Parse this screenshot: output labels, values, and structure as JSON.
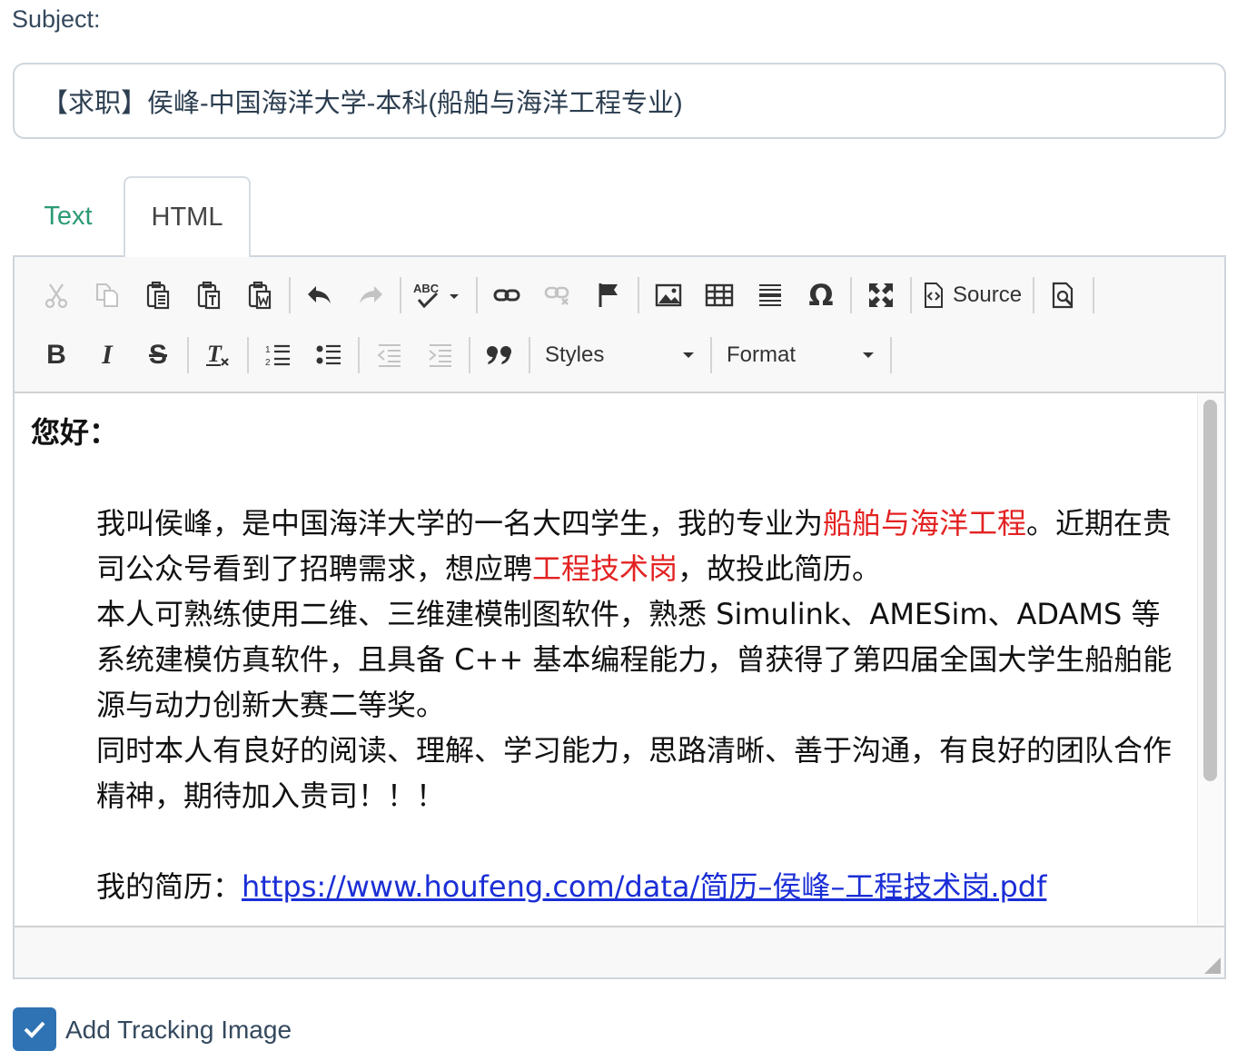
{
  "subject": {
    "label": "Subject:",
    "value": "【求职】侯峰-中国海洋大学-本科(船舶与海洋工程专业)"
  },
  "tabs": [
    {
      "label": "Text",
      "active": false
    },
    {
      "label": "HTML",
      "active": true
    }
  ],
  "toolbar": {
    "row1_icons": [
      "cut-icon",
      "copy-icon",
      "paste-icon",
      "paste-text-icon",
      "paste-word-icon",
      "undo-icon",
      "redo-icon",
      "spellcheck-icon",
      "link-icon",
      "unlink-icon",
      "anchor-flag-icon",
      "image-icon",
      "table-icon",
      "horizontal-rule-icon",
      "special-char-icon",
      "maximize-icon",
      "source-icon",
      "preview-icon"
    ],
    "source_label": "Source",
    "spell_label": "ABC",
    "row2_icons": [
      "bold-icon",
      "italic-icon",
      "strikethrough-icon",
      "remove-format-icon",
      "numbered-list-icon",
      "bullet-list-icon",
      "outdent-icon",
      "indent-icon",
      "blockquote-icon"
    ],
    "bold_glyph": "B",
    "italic_glyph": "I",
    "strike_glyph": "S",
    "styles_label": "Styles",
    "format_label": "Format"
  },
  "body": {
    "greeting": "您好：",
    "p1_a": "我叫侯峰，是中国海洋大学的一名大四学生，我的专业为",
    "p1_major": "船舶与海洋工程",
    "p1_b": "。近期在贵司公众号看到了招聘需求，想应聘",
    "p1_position": "工程技术岗",
    "p1_c": "，故投此简历。",
    "p2": "本人可熟练使用二维、三维建模制图软件，熟悉 Simulink、AMESim、ADAMS 等系统建模仿真软件，且具备 C++ 基本编程能力，曾获得了第四届全国大学生船舶能源与动力创新大赛二等奖。",
    "p3": "同时本人有良好的阅读、理解、学习能力，思路清晰、善于沟通，有良好的团队合作精神，期待加入贵司！！！",
    "resume_label": "我的简历：",
    "resume_link": "https://www.houfeng.com/data/简历–侯峰–工程技术岗.pdf"
  },
  "colors": {
    "accent_tab": "#2b9a76",
    "highlight_red": "#e32222",
    "link_blue": "#1a2ed6",
    "checkbox": "#2f73b4"
  },
  "tracking": {
    "label": "Add Tracking Image",
    "checked": true
  }
}
